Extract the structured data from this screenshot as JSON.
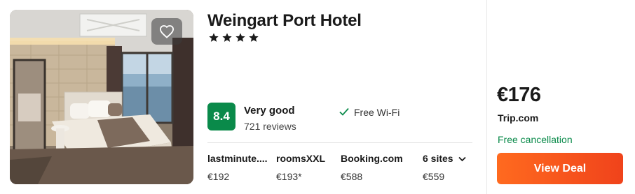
{
  "hotel": {
    "name": "Weingart Port Hotel",
    "star_count": 4,
    "star_glyph": "★"
  },
  "rating": {
    "score": "8.4",
    "label": "Very good",
    "reviews": "721 reviews",
    "badge_color": "#0a8a4a"
  },
  "amenities": [
    {
      "label": "Free Wi-Fi",
      "icon": "checkmark-icon"
    }
  ],
  "offers": [
    {
      "site": "lastminute....",
      "price": "€192"
    },
    {
      "site": "roomsXXL",
      "price": "€193*"
    },
    {
      "site": "Booking.com",
      "price": "€588"
    }
  ],
  "more_sites": {
    "label": "6 sites",
    "price": "€559",
    "icon": "chevron-down-icon"
  },
  "deal": {
    "price": "€176",
    "provider": "Trip.com",
    "cancellation": "Free cancellation",
    "button_label": "View Deal",
    "accent_color": "#f0431b",
    "cancellation_color": "#0a8a4a"
  },
  "icons": {
    "favorite": "heart-outline-icon"
  }
}
